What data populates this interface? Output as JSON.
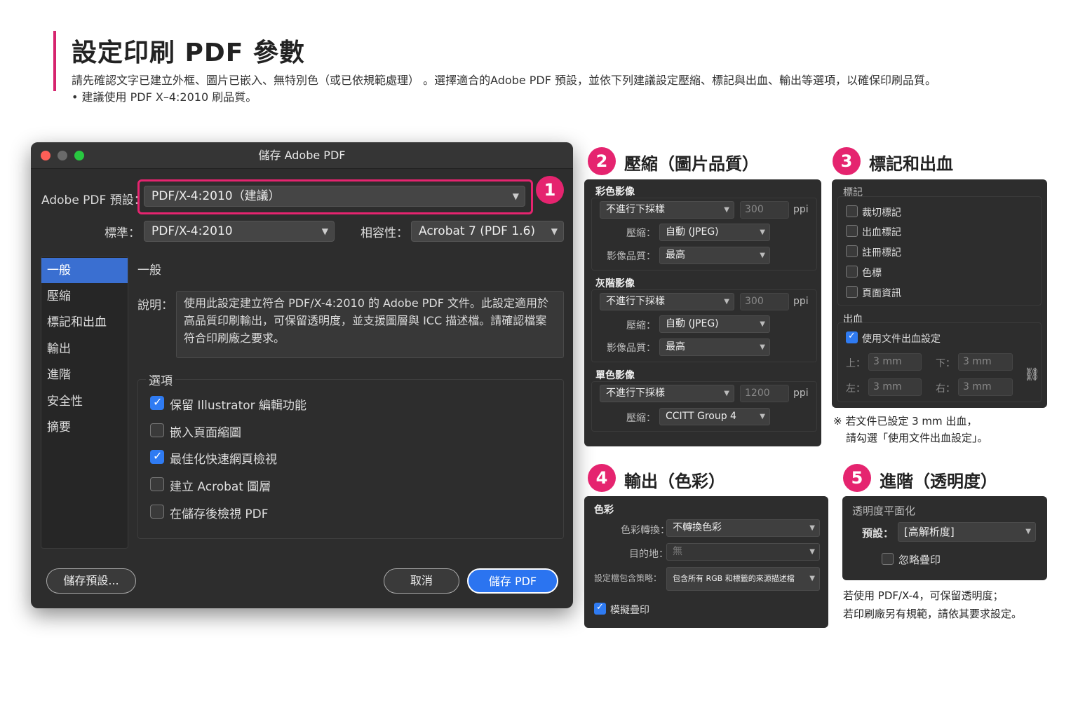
{
  "header": {
    "title": "設定印刷 PDF 參數",
    "desc": "請先確認文字已建立外框、圖片已嵌入、無特別色（或已依規範處理）  。選擇適合的Adobe PDF 預設，並依下列建議設定壓縮、標記與出血、輸出等選項，以確保印刷品質。",
    "bullet": "• 建議使用 PDF X–4:2010 刷品質。"
  },
  "dialog": {
    "title": "儲存 Adobe PDF",
    "preset_label": "Adobe PDF 預設：",
    "preset_value": "PDF/X-4:2010（建議）",
    "badge": "1",
    "standard_label": "標準：",
    "standard_value": "PDF/X-4:2010",
    "compat_label": "相容性：",
    "compat_value": "Acrobat 7 (PDF 1.6)",
    "sidebar": [
      {
        "label": "一般"
      },
      {
        "label": "壓縮"
      },
      {
        "label": "標記和出血"
      },
      {
        "label": "輸出"
      },
      {
        "label": "進階"
      },
      {
        "label": "安全性"
      },
      {
        "label": "摘要"
      }
    ],
    "section_title": "一般",
    "desc_label": "說明：",
    "desc_text": "使用此設定建立符合 PDF/X-4:2010 的 Adobe PDF 文件。此設定適用於高品質印刷輸出，可保留透明度，並支援圖層與 ICC 描述檔。請確認檔案符合印刷廠之要求。",
    "options_title": "選項",
    "options": [
      {
        "label": "保留 Illustrator 編輯功能",
        "checked": true
      },
      {
        "label": "嵌入頁面縮圖",
        "checked": false
      },
      {
        "label": "最佳化快速網頁檢視",
        "checked": true
      },
      {
        "label": "建立 Acrobat 圖層",
        "checked": false
      },
      {
        "label": "在儲存後檢視 PDF",
        "checked": false
      }
    ],
    "save_preset": "儲存預設...",
    "cancel": "取消",
    "save_pdf": "儲存 PDF"
  },
  "compress": {
    "badge": "2",
    "title": "壓縮（圖片品質）",
    "groups": [
      {
        "name": "彩色影像",
        "sample": "不進行下採樣",
        "ppi": "300",
        "unit": "ppi",
        "comp_label": "壓縮：",
        "comp": "自動 (JPEG)",
        "q_label": "影像品質：",
        "q": "最高"
      },
      {
        "name": "灰階影像",
        "sample": "不進行下採樣",
        "ppi": "300",
        "unit": "ppi",
        "comp_label": "壓縮：",
        "comp": "自動 (JPEG)",
        "q_label": "影像品質：",
        "q": "最高"
      },
      {
        "name": "單色影像",
        "sample": "不進行下採樣",
        "ppi": "1200",
        "unit": "ppi",
        "comp_label": "壓縮：",
        "comp": "CCITT Group 4"
      }
    ]
  },
  "marks": {
    "badge": "3",
    "title": "標記和出血",
    "marks_head": "標記",
    "items": [
      {
        "label": "裁切標記"
      },
      {
        "label": "出血標記"
      },
      {
        "label": "註冊標記"
      },
      {
        "label": "色標"
      },
      {
        "label": "頁面資訊"
      }
    ],
    "bleed_head": "出血",
    "use_doc": "使用文件出血設定",
    "top_l": "上：",
    "top": "3 mm",
    "bottom_l": "下：",
    "bottom": "3 mm",
    "left_l": "左：",
    "left": "3 mm",
    "right_l": "右：",
    "right": "3 mm",
    "note1": "※ 若文件已設定 3 mm 出血，",
    "note2": "請勾選「使用文件出血設定」。"
  },
  "output": {
    "badge": "4",
    "title": "輸出（色彩）",
    "head": "色彩",
    "conv_l": "色彩轉換：",
    "conv": "不轉換色彩",
    "dest_l": "目的地：",
    "dest": "無",
    "policy_l": "設定檔包含策略：",
    "policy": "包含所有 RGB 和標籤的來源描述檔",
    "overprint": "模擬疊印"
  },
  "advanced": {
    "badge": "5",
    "title": "進階（透明度）",
    "head": "透明度平面化",
    "preset_l": "預設：",
    "preset": "[高解析度]",
    "ignore": "忽略疊印",
    "note1": "若使用 PDF/X-4，可保留透明度；",
    "note2": "若印刷廠另有規範，請依其要求設定。"
  }
}
